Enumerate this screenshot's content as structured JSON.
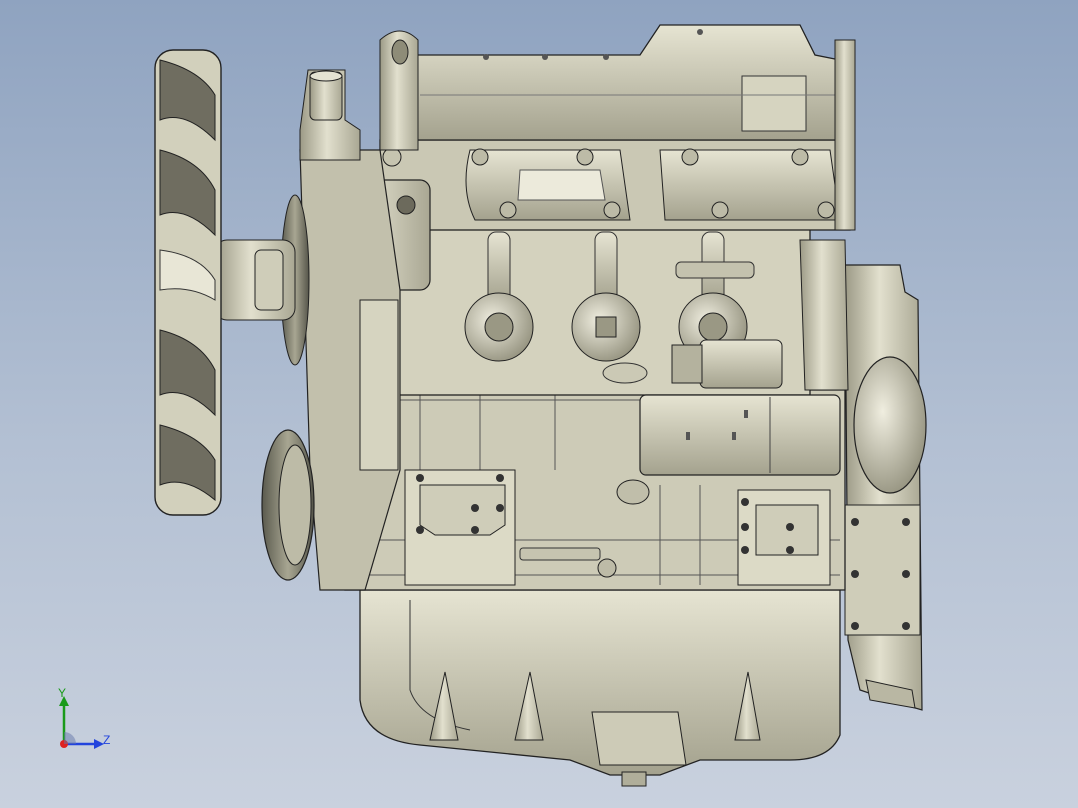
{
  "viewport": {
    "background_top": "#8fa3c0",
    "background_bottom": "#c9d1de",
    "model_color": "#d8d6c4",
    "edge_color": "#222222"
  },
  "triad": {
    "y_label": "Y",
    "z_label": "Z",
    "y_color": "#1a9a1a",
    "z_color": "#2244dd",
    "x_color": "#dd2222"
  }
}
